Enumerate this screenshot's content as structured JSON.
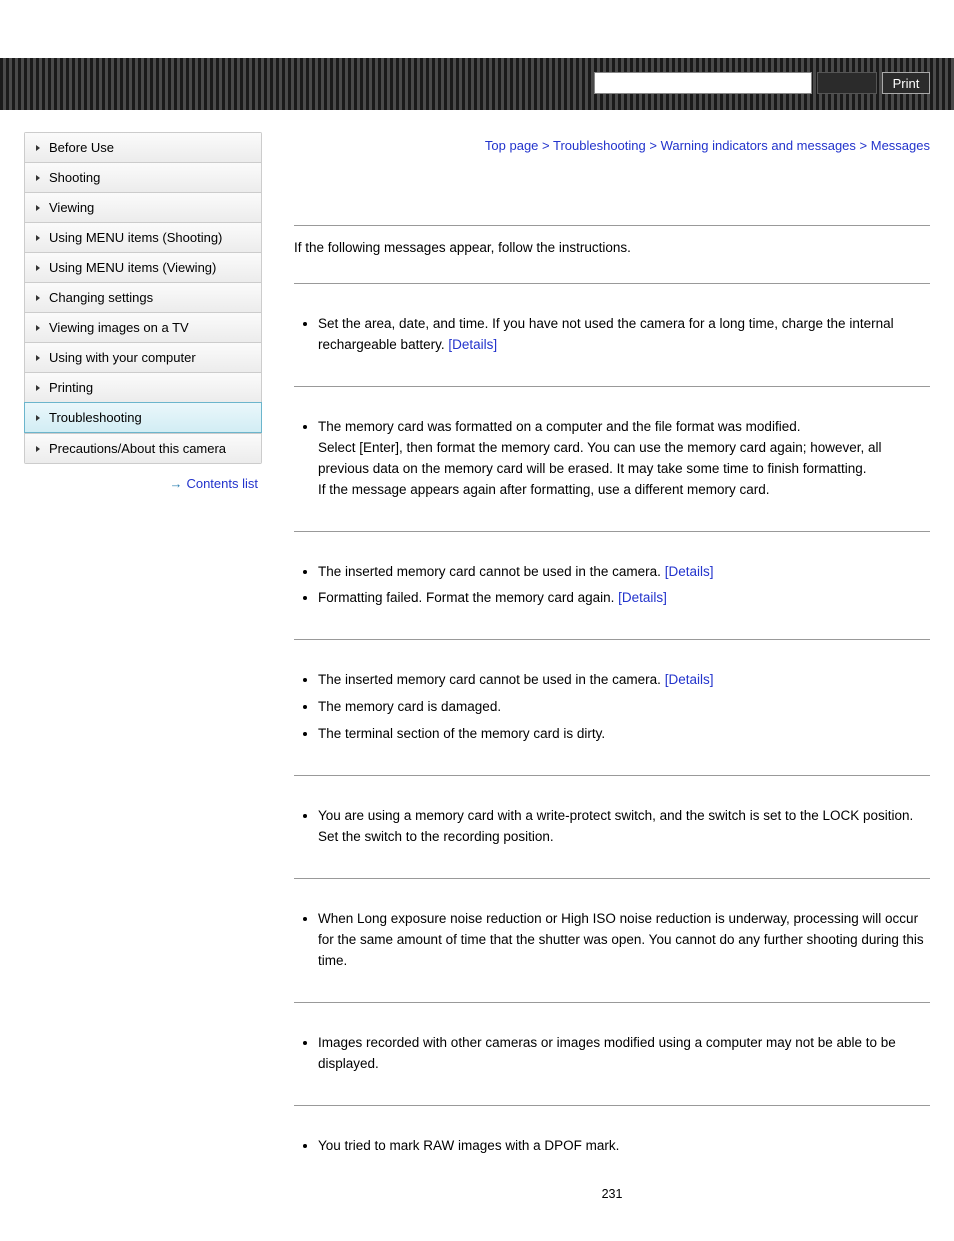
{
  "header": {
    "print_label": "Print"
  },
  "breadcrumb": {
    "items": [
      "Top page",
      "Troubleshooting",
      "Warning indicators and messages",
      "Messages"
    ],
    "sep": ">"
  },
  "sidebar": {
    "items": [
      {
        "label": "Before Use"
      },
      {
        "label": "Shooting"
      },
      {
        "label": "Viewing"
      },
      {
        "label": "Using MENU items (Shooting)"
      },
      {
        "label": "Using MENU items (Viewing)"
      },
      {
        "label": "Changing settings"
      },
      {
        "label": "Viewing images on a TV"
      },
      {
        "label": "Using with your computer"
      },
      {
        "label": "Printing"
      },
      {
        "label": "Troubleshooting"
      },
      {
        "label": "Precautions/About this camera"
      }
    ],
    "active_index": 9,
    "contents_list_label": "Contents list"
  },
  "main": {
    "intro": "If the following messages appear, follow the instructions.",
    "details_label": "[Details]",
    "sections": [
      {
        "items": [
          {
            "text": "Set the area, date, and time. If you have not used the camera for a long time, charge the internal rechargeable battery. ",
            "has_details": true
          }
        ]
      },
      {
        "items": [
          {
            "text": "The memory card was formatted on a computer and the file format was modified.\nSelect [Enter], then format the memory card. You can use the memory card again; however, all previous data on the memory card will be erased. It may take some time to finish formatting.\nIf the message appears again after formatting, use a different memory card.",
            "has_details": false
          }
        ]
      },
      {
        "items": [
          {
            "text": "The inserted memory card cannot be used in the camera. ",
            "has_details": true
          },
          {
            "text": "Formatting failed. Format the memory card again. ",
            "has_details": true
          }
        ]
      },
      {
        "items": [
          {
            "text": "The inserted memory card cannot be used in the camera. ",
            "has_details": true
          },
          {
            "text": "The memory card is damaged.",
            "has_details": false
          },
          {
            "text": "The terminal section of the memory card is dirty.",
            "has_details": false
          }
        ]
      },
      {
        "items": [
          {
            "text": "You are using a memory card with a write-protect switch, and the switch is set to the LOCK position. Set the switch to the recording position.",
            "has_details": false
          }
        ]
      },
      {
        "items": [
          {
            "text": "When Long exposure noise reduction or High ISO noise reduction is underway, processing will occur for the same amount of time that the shutter was open. You cannot do any further shooting during this time.",
            "has_details": false
          }
        ]
      },
      {
        "items": [
          {
            "text": "Images recorded with other cameras or images modified using a computer may not be able to be displayed.",
            "has_details": false
          }
        ]
      },
      {
        "items": [
          {
            "text": "You tried to mark RAW images with a DPOF mark.",
            "has_details": false
          }
        ]
      }
    ],
    "page_number": "231"
  }
}
